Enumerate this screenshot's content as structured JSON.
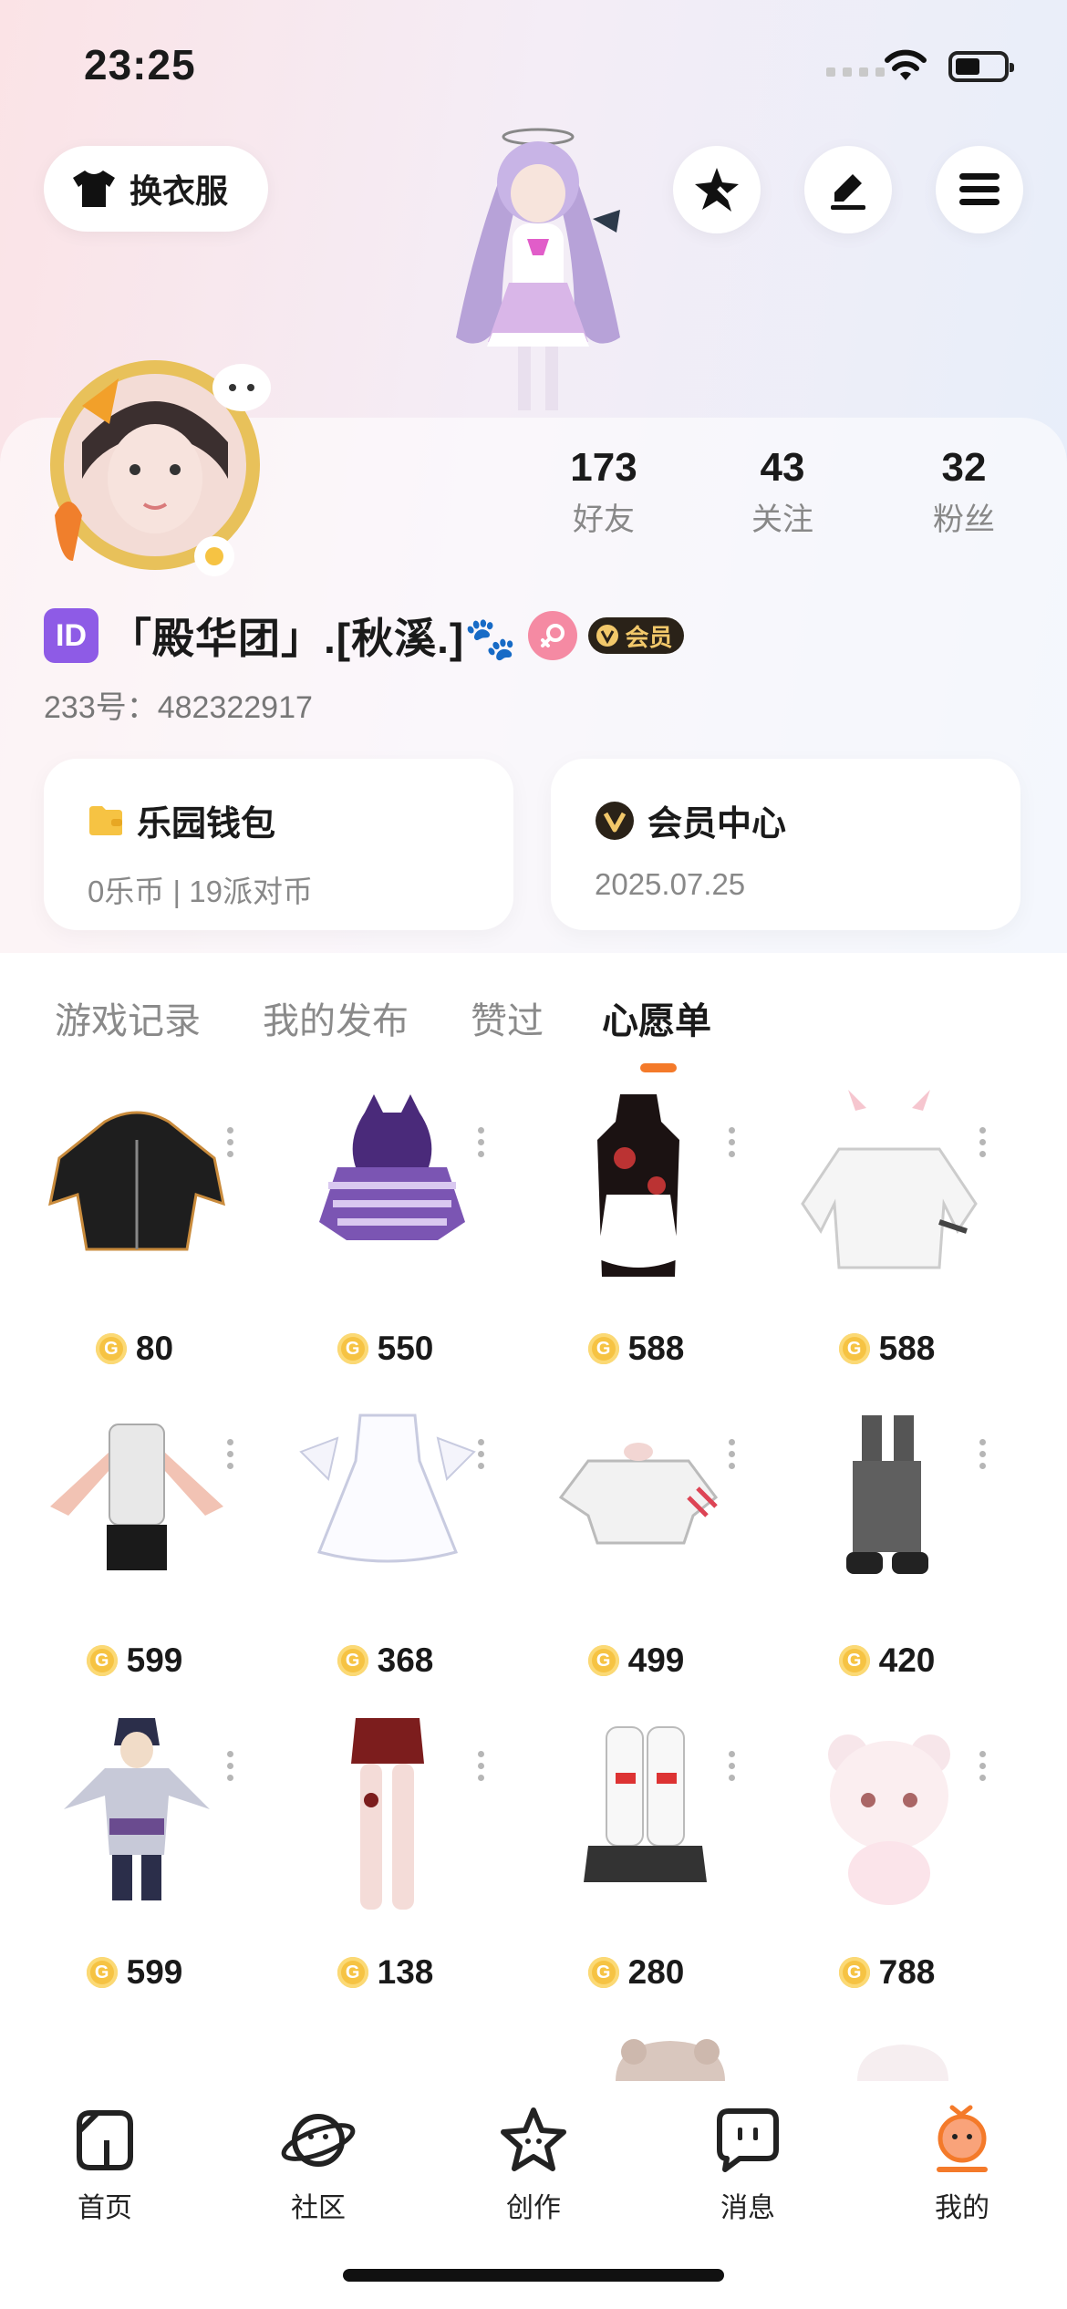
{
  "status_bar": {
    "time": "23:25"
  },
  "header": {
    "dress_button_label": "换衣服"
  },
  "profile": {
    "stats": [
      {
        "value": "173",
        "label": "好友"
      },
      {
        "value": "43",
        "label": "关注"
      },
      {
        "value": "32",
        "label": "粉丝"
      }
    ],
    "id_badge": "ID",
    "name": "「殿华团」.[秋溪.]🐾",
    "vip_label": "会员",
    "uid": "233号：482322917"
  },
  "cards": {
    "wallet": {
      "title": "乐园钱包",
      "sub": "0乐币 | 19派对币"
    },
    "vip": {
      "title": "会员中心",
      "sub": "2025.07.25"
    }
  },
  "tabs": [
    {
      "label": "游戏记录"
    },
    {
      "label": "我的发布"
    },
    {
      "label": "赞过"
    },
    {
      "label": "心愿单"
    }
  ],
  "wishlist": [
    {
      "name": "black-hoodie-dress",
      "price": "80"
    },
    {
      "name": "purple-cat-hoodie",
      "price": "550"
    },
    {
      "name": "qipao-maid-dress",
      "price": "588"
    },
    {
      "name": "white-sweater-cat-ears",
      "price": "588"
    },
    {
      "name": "white-knit-top-black-skirt",
      "price": "599"
    },
    {
      "name": "white-lace-dress",
      "price": "368"
    },
    {
      "name": "white-offshoulder-top",
      "price": "499"
    },
    {
      "name": "grey-cargo-pants",
      "price": "420"
    },
    {
      "name": "ninja-outfit",
      "price": "599"
    },
    {
      "name": "red-shorts-stockings",
      "price": "138"
    },
    {
      "name": "white-leg-warmers-shoes",
      "price": "280"
    },
    {
      "name": "pink-doll-costume",
      "price": "788"
    }
  ],
  "bottom_nav": [
    {
      "label": "首页",
      "icon": "home-icon"
    },
    {
      "label": "社区",
      "icon": "planet-icon"
    },
    {
      "label": "创作",
      "icon": "star-icon"
    },
    {
      "label": "消息",
      "icon": "chat-icon"
    },
    {
      "label": "我的",
      "icon": "profile-face-icon"
    }
  ],
  "colors": {
    "accent": "#f47a2a",
    "coin": "#f6c343",
    "id_badge": "#8e5be6",
    "gender_badge": "#f58aa3"
  }
}
